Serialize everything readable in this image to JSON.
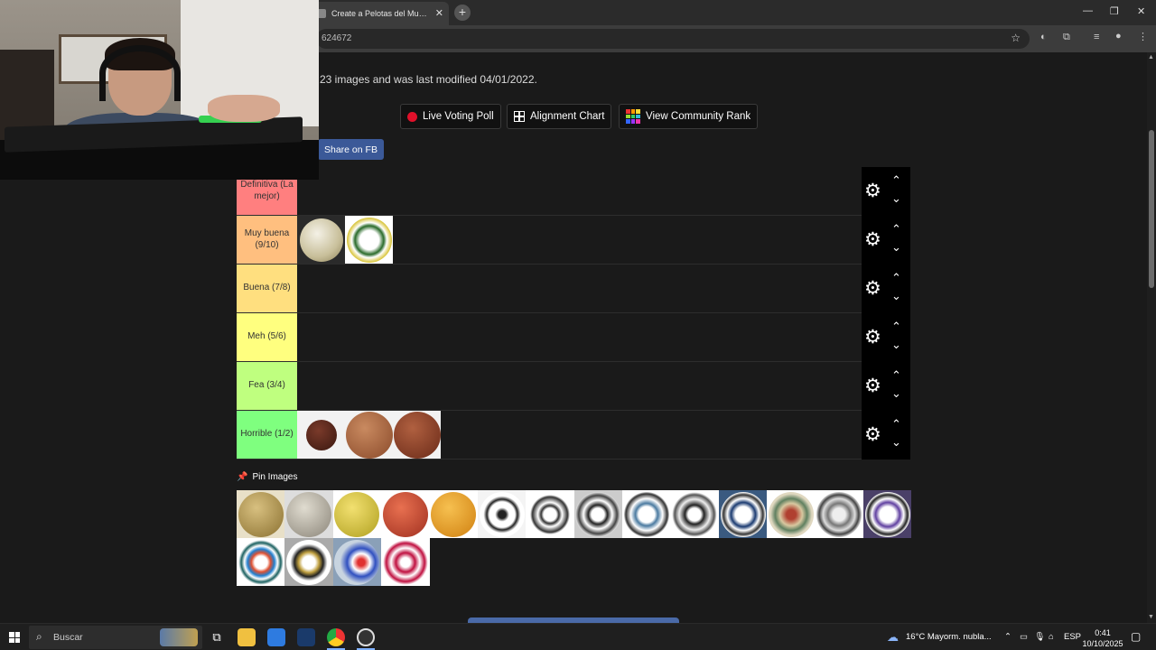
{
  "browser": {
    "tab_title": "Create a Pelotas del Mundial (U",
    "tab_close": "✕",
    "new_tab": "+",
    "url": "624672",
    "star": "☆",
    "min": "—",
    "max": "❐",
    "close": "✕"
  },
  "page": {
    "meta_text": "23 images and was last modified 04/01/2022.",
    "buttons": {
      "live_poll": "Live Voting Poll",
      "alignment": "Alignment Chart",
      "community": "View Community Rank"
    },
    "share_fb": "Share on FB",
    "tiers": [
      {
        "label": "Definitiva (La mejor)",
        "color": "#ff7f7f"
      },
      {
        "label": "Muy buena (9/10)",
        "color": "#ffbf7f"
      },
      {
        "label": "Buena (7/8)",
        "color": "#ffdf7f"
      },
      {
        "label": "Meh (5/6)",
        "color": "#ffff7f"
      },
      {
        "label": "Fea (3/4)",
        "color": "#bfff7f"
      },
      {
        "label": "Horrible (1/2)",
        "color": "#7fff7f"
      }
    ],
    "pin_label": "Pin Images",
    "up_arrow": "⌃",
    "down_arrow": "⌄",
    "gear": "⚙"
  },
  "taskbar": {
    "search_placeholder": "Buscar",
    "weather": "16°C  Mayorm. nubla...",
    "lang": "ESP",
    "time": "0:41",
    "date": "10/10/2025"
  }
}
